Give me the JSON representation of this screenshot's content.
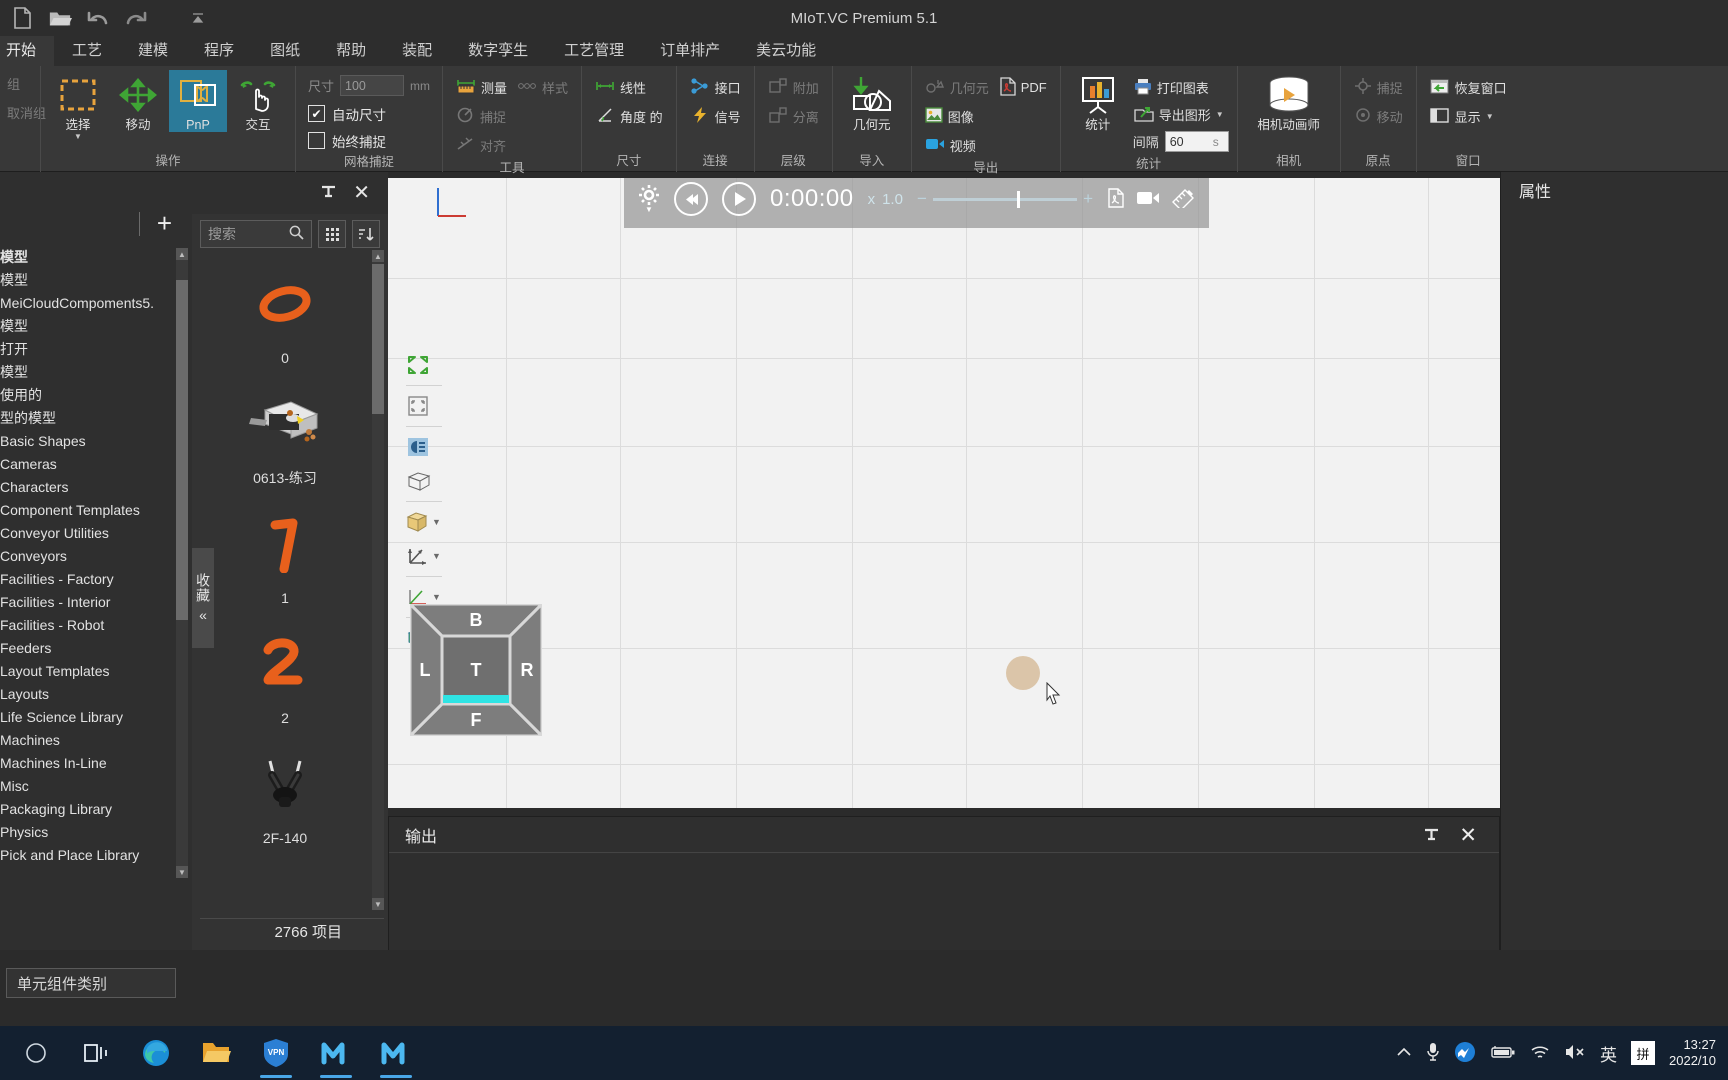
{
  "app": {
    "title": "MIoT.VC Premium 5.1"
  },
  "quick_access": {
    "items": [
      {
        "name": "new-file-icon",
        "label": "新建"
      },
      {
        "name": "open-folder-icon",
        "label": "打开"
      },
      {
        "name": "undo-icon",
        "label": "撤销"
      },
      {
        "name": "redo-icon",
        "label": "重做"
      },
      {
        "name": "customize-caret-icon",
        "label": "自定义"
      }
    ]
  },
  "ribbon": {
    "tabs": [
      {
        "label": "开始",
        "active": true
      },
      {
        "label": "工艺",
        "active": false
      },
      {
        "label": "建模",
        "active": false
      },
      {
        "label": "程序",
        "active": false
      },
      {
        "label": "图纸",
        "active": false
      },
      {
        "label": "帮助",
        "active": false
      },
      {
        "label": "装配",
        "active": false
      },
      {
        "label": "数字孪生",
        "active": false
      },
      {
        "label": "工艺管理",
        "active": false
      },
      {
        "label": "订单排产",
        "active": false
      },
      {
        "label": "美云功能",
        "active": false
      }
    ],
    "groups": {
      "clipboard": {
        "title": "",
        "items": [
          {
            "label": "组",
            "disabled": true
          },
          {
            "label": "取消组",
            "disabled": true
          }
        ]
      },
      "operate": {
        "title": "操作",
        "buttons": [
          {
            "label": "选择",
            "icon": "select-icon",
            "selected": false,
            "has_caret": true
          },
          {
            "label": "移动",
            "icon": "move-icon",
            "selected": false,
            "has_caret": false
          },
          {
            "label": "PnP",
            "icon": "pnp-icon",
            "selected": true,
            "has_caret": false
          },
          {
            "label": "交互",
            "icon": "interact-icon",
            "selected": false,
            "has_caret": false
          }
        ]
      },
      "grid_snap": {
        "title": "网格捕捉",
        "size_label": "尺寸",
        "size_value": "100",
        "size_unit": "mm",
        "checkboxes": [
          {
            "label": "自动尺寸",
            "checked": true
          },
          {
            "label": "始终捕捉",
            "checked": false
          }
        ]
      },
      "tools": {
        "title": "工具",
        "items": [
          {
            "label": "测量",
            "icon": "measure-icon",
            "disabled": false
          },
          {
            "label": "样式",
            "icon": "style-icon",
            "disabled": true
          },
          {
            "label": "捕捉",
            "icon": "snap-icon",
            "disabled": true
          },
          {
            "label": "对齐",
            "icon": "align-icon",
            "disabled": true
          }
        ]
      },
      "dimension": {
        "title": "尺寸",
        "items": [
          {
            "label": "线性",
            "icon": "linear-dimension-icon",
            "disabled": false
          },
          {
            "label": "角度 的",
            "icon": "angular-dimension-icon",
            "disabled": false
          }
        ]
      },
      "connect": {
        "title": "连接",
        "items": [
          {
            "label": "接口",
            "icon": "interface-icon",
            "disabled": false
          },
          {
            "label": "信号",
            "icon": "signal-icon",
            "disabled": false
          }
        ]
      },
      "hierarchy": {
        "title": "层级",
        "items": [
          {
            "label": "附加",
            "icon": "attach-icon",
            "disabled": true
          },
          {
            "label": "分离",
            "icon": "detach-icon",
            "disabled": true
          }
        ]
      },
      "import": {
        "title": "导入",
        "buttons": [
          {
            "label": "几何元",
            "icon": "import-geometry-icon"
          }
        ]
      },
      "export": {
        "title": "导出",
        "items": [
          {
            "label": "几何元",
            "icon": "export-geometry-icon",
            "disabled": true
          },
          {
            "label": "PDF",
            "icon": "pdf-icon",
            "disabled": false
          },
          {
            "label": "图像",
            "icon": "image-icon",
            "disabled": false
          },
          {
            "label": "视频",
            "icon": "video-icon",
            "disabled": false
          }
        ]
      },
      "statistics": {
        "title": "统计",
        "buttons": [
          {
            "label": "统计",
            "icon": "statistics-icon"
          }
        ],
        "items": [
          {
            "label": "打印图表",
            "icon": "print-chart-icon"
          },
          {
            "label": "导出图形",
            "icon": "export-chart-icon",
            "has_caret": true
          }
        ],
        "interval_label": "间隔",
        "interval_value": "60",
        "interval_unit": "s"
      },
      "camera": {
        "title": "相机",
        "buttons": [
          {
            "label": "相机动画师",
            "icon": "camera-animator-icon"
          }
        ]
      },
      "origin": {
        "title": "原点",
        "items": [
          {
            "label": "捕捉",
            "icon": "origin-snap-icon",
            "disabled": true
          },
          {
            "label": "移动",
            "icon": "origin-move-icon",
            "disabled": true
          }
        ]
      },
      "window": {
        "title": "窗口",
        "items": [
          {
            "label": "恢复窗口",
            "icon": "restore-window-icon",
            "disabled": false
          },
          {
            "label": "显示",
            "icon": "show-window-icon",
            "disabled": false,
            "has_caret": true
          }
        ]
      }
    }
  },
  "library_tree": {
    "nodes": [
      {
        "label": "模型",
        "bold": true
      },
      {
        "label": "模型",
        "bold": false
      },
      {
        "label": "MeiCloudCompoments5.",
        "bold": false
      },
      {
        "label": "模型",
        "bold": false
      },
      {
        "label": "打开",
        "bold": false
      },
      {
        "label": "模型",
        "bold": false
      },
      {
        "label": "使用的",
        "bold": false
      },
      {
        "label": "型的模型",
        "bold": false
      },
      {
        "label": "Basic Shapes",
        "bold": false
      },
      {
        "label": "Cameras",
        "bold": false
      },
      {
        "label": "Characters",
        "bold": false
      },
      {
        "label": "Component Templates",
        "bold": false
      },
      {
        "label": "Conveyor Utilities",
        "bold": false
      },
      {
        "label": "Conveyors",
        "bold": false
      },
      {
        "label": "Facilities - Factory",
        "bold": false
      },
      {
        "label": "Facilities - Interior",
        "bold": false
      },
      {
        "label": "Facilities - Robot",
        "bold": false
      },
      {
        "label": "Feeders",
        "bold": false
      },
      {
        "label": "Layout Templates",
        "bold": false
      },
      {
        "label": "Layouts",
        "bold": false
      },
      {
        "label": "Life Science Library",
        "bold": false
      },
      {
        "label": "Machines",
        "bold": false
      },
      {
        "label": "Machines In-Line",
        "bold": false
      },
      {
        "label": "Misc",
        "bold": false
      },
      {
        "label": "Packaging Library",
        "bold": false
      },
      {
        "label": "Physics",
        "bold": false
      },
      {
        "label": "Pick and Place Library",
        "bold": false
      }
    ]
  },
  "component_panel": {
    "search_placeholder": "搜索",
    "pin_icon": "pin-icon",
    "close_icon": "close-icon",
    "grid_view_icon": "grid-view-icon",
    "sort_icon": "sort-icon",
    "favorites_tab_label": "收藏",
    "favorites_collapse_icon": "chevron-left-icon",
    "count_label": "2766 项目",
    "items": [
      {
        "name": "0",
        "thumb": "orange-zero-thumb"
      },
      {
        "name": "0613-练习",
        "thumb": "layout-scene-thumb"
      },
      {
        "name": "1",
        "thumb": "orange-one-thumb"
      },
      {
        "name": "2",
        "thumb": "orange-two-thumb"
      },
      {
        "name": "2F-140",
        "thumb": "gripper-thumb"
      }
    ]
  },
  "viewport": {
    "player": {
      "gear_icon": "settings-gear-icon",
      "rewind_icon": "rewind-icon",
      "play_icon": "play-icon",
      "time": "0:00:00",
      "speed_prefix": "x",
      "speed_value": "1.0",
      "pdf_icon": "pdf-record-icon",
      "video_icon": "video-record-icon",
      "measure_icon": "ruler-icon"
    },
    "tools": [
      {
        "name": "fit-view-icon",
        "caret": false
      },
      {
        "name": "zoom-to-selection-icon",
        "caret": false
      },
      {
        "name": "lighting-icon",
        "caret": false
      },
      {
        "name": "wireframe-cube-icon",
        "caret": false
      },
      {
        "name": "render-mode-icon",
        "caret": true
      },
      {
        "name": "coordinate-frames-icon",
        "caret": true
      },
      {
        "name": "origin-frame-icon",
        "caret": true
      },
      {
        "name": "color-cube-icon",
        "caret": true
      }
    ],
    "viewcube": {
      "top": "B",
      "left": "L",
      "center": "T",
      "right": "R",
      "bottom": "F"
    }
  },
  "output_panel": {
    "title": "输出",
    "pin_icon": "pin-icon",
    "close_icon": "close-icon"
  },
  "properties_panel": {
    "title": "属性"
  },
  "status_bar": {
    "category_value": "单元组件类别"
  },
  "taskbar": {
    "apps": [
      {
        "name": "task-view-icon",
        "active": false
      },
      {
        "name": "edge-browser-icon",
        "active": false
      },
      {
        "name": "file-explorer-icon",
        "active": false
      },
      {
        "name": "vpn-app-icon",
        "active": true
      },
      {
        "name": "miot-app-icon",
        "active": true
      },
      {
        "name": "miot-app-icon-2",
        "active": true
      }
    ],
    "tray": [
      {
        "name": "show-hidden-icons-chevron"
      },
      {
        "name": "microphone-icon"
      },
      {
        "name": "messenger-icon"
      },
      {
        "name": "battery-icon"
      },
      {
        "name": "wifi-icon"
      },
      {
        "name": "volume-muted-icon"
      }
    ],
    "ime_lang": "英",
    "ime_mode": "拼",
    "time": "13:27",
    "date": "2022/10"
  },
  "colors": {
    "accent": "#2b7a99",
    "ribbon_bg": "#383838",
    "panel_bg": "#2f2f2f",
    "viewport_bg": "#f2f2f2",
    "taskbar_bg": "#132030",
    "orange": "#e8601c",
    "green": "#3fa535",
    "cyan": "#2fe4e4"
  }
}
